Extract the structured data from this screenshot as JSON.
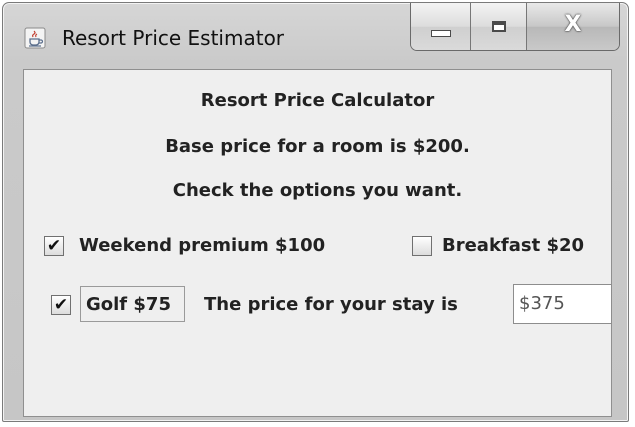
{
  "window": {
    "title": "Resort Price Estimator",
    "app_icon": "java-cup-icon",
    "controls": {
      "minimize": "minimize-icon",
      "maximize": "maximize-icon",
      "close_glyph": "X"
    }
  },
  "content": {
    "heading": "Resort Price Calculator",
    "base_price_text": "Base price for a room is $200.",
    "instruction_text": "Check the options you want.",
    "options": {
      "weekend": {
        "label": "Weekend premium $100",
        "checked": true
      },
      "breakfast": {
        "label": "Breakfast $20",
        "checked": false
      },
      "golf": {
        "label": "Golf $75",
        "checked": true
      }
    },
    "total_label": "The price for your stay is",
    "total_value": "$375"
  },
  "check_mark": "✔"
}
